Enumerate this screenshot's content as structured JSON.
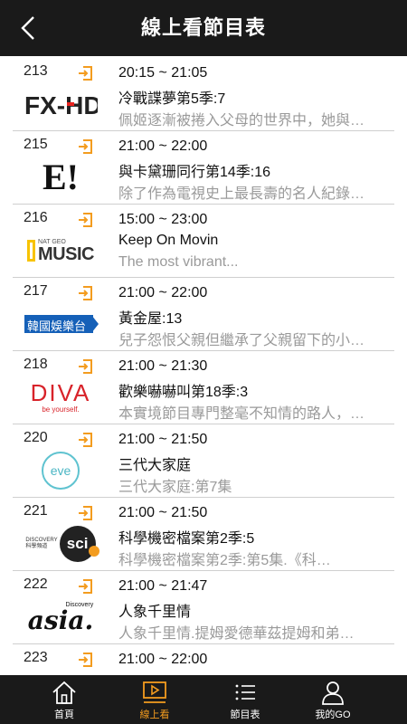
{
  "header": {
    "title": "線上看節目表"
  },
  "rows": [
    {
      "channel": "213",
      "logo_text": "FX-HD",
      "time": "20:15 ~ 21:05",
      "program": "冷戰諜夢第5季:7",
      "description": "佩姬逐漸被捲入父母的世界中，她與…"
    },
    {
      "channel": "215",
      "logo_text": "E!",
      "time": "21:00 ~ 22:00",
      "program": "與卡黛珊同行第14季:16",
      "description": "除了作為電視史上最長壽的名人紀錄…"
    },
    {
      "channel": "216",
      "logo_text_top": "NAT GEO",
      "logo_text_main": "MUSIC",
      "time": "15:00 ~ 23:00",
      "program": "Keep On Movin",
      "description": "The most vibrant..."
    },
    {
      "channel": "217",
      "logo_text": "韓國娛樂台",
      "time": "21:00 ~ 22:00",
      "program": "黃金屋:13",
      "description": "兒子怨恨父親但繼承了父親留下的小…"
    },
    {
      "channel": "218",
      "logo_text_main": "DIVA",
      "logo_text_sub": "be yourself.",
      "time": "21:00 ~ 21:30",
      "program": "歡樂嚇嚇叫第18季:3",
      "description": "本實境節目專門整毫不知情的路人，…"
    },
    {
      "channel": "220",
      "logo_text": "eve",
      "time": "21:00 ~ 21:50",
      "program": "三代大家庭",
      "description": "三代大家庭:第7集"
    },
    {
      "channel": "221",
      "logo_text_top": "DISCOVERY",
      "logo_text_sub": "科學頻道",
      "logo_text_main": "sci",
      "time": "21:00 ~ 21:50",
      "program": "科學機密檔案第2季:5",
      "description": "科學機密檔案第2季:第5集.《科…"
    },
    {
      "channel": "222",
      "logo_text_top": "Discovery",
      "logo_text_main": "asia.",
      "time": "21:00 ~ 21:47",
      "program": "人象千里情",
      "description": "人象千里情.提姆愛德華茲提姆和弟…"
    },
    {
      "channel": "223",
      "time": "21:00 ~ 22:00"
    }
  ],
  "tabs": [
    {
      "label": "首頁",
      "icon": "home-icon"
    },
    {
      "label": "線上看",
      "icon": "play-screen-icon",
      "active": true
    },
    {
      "label": "節目表",
      "icon": "list-icon"
    },
    {
      "label": "我的GO",
      "icon": "user-icon"
    }
  ],
  "colors": {
    "accent": "#f39c1f",
    "bar": "#1a1a1a"
  }
}
